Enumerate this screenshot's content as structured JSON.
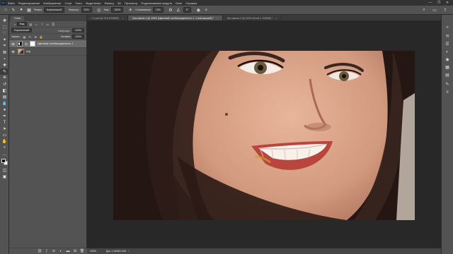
{
  "menubar": {
    "logo": "Ps",
    "items": [
      "Файл",
      "Редактирование",
      "Изображение",
      "Слои",
      "Текст",
      "Выделение",
      "Фильтр",
      "3D",
      "Просмотр",
      "Подключаемые модули",
      "Окно",
      "Справка"
    ],
    "controls": [
      "—",
      "❐",
      "✕"
    ]
  },
  "optbar": {
    "mode_label": "Режим:",
    "mode_value": "Нормальный",
    "opacity_label": "Непрозр.:",
    "opacity_value": "30%",
    "flow_label": "Наж.:",
    "flow_value": "100%",
    "smoothing_label": "Сглаживание:",
    "smoothing_value": "10%",
    "angle_value": "0°"
  },
  "doc_tabs": [
    {
      "label": "1-2.psd @ 75% (RGB/8*)",
      "active": false
    },
    {
      "label": "Без имени-1 @ 100% (Цветовой тон/Насыщенность 1, Слой-маска/8) *",
      "active": true
    },
    {
      "label": "Без имени-2 @ 100% (Слой 1, RGB/8) *",
      "active": false
    }
  ],
  "layers_panel": {
    "tab": "Слои",
    "filter_label": "Вид",
    "blend": "Нормальный",
    "opacity_label": "Непрозр.:",
    "opacity_value": "100%",
    "lock_label": "Закреп.:",
    "fill_label": "Заливка:",
    "fill_value": "100%",
    "layers": [
      {
        "name": "Цветовой тон/Насыщенность 1",
        "selected": true,
        "kind": "adjustment"
      },
      {
        "name": "img",
        "selected": false,
        "kind": "photo"
      }
    ],
    "footer_icons": [
      "link-icon",
      "fx-icon",
      "mask-icon",
      "adjustment-icon",
      "folder-icon",
      "new-layer-icon",
      "trash-icon"
    ]
  },
  "status": {
    "zoom": "100%",
    "doc": "Док: 1,04M/2,12M",
    "arrow": "›"
  },
  "colors": {
    "ui_bg": "#535353",
    "canvas_bg": "#282828",
    "menubar_bg": "#323232"
  }
}
